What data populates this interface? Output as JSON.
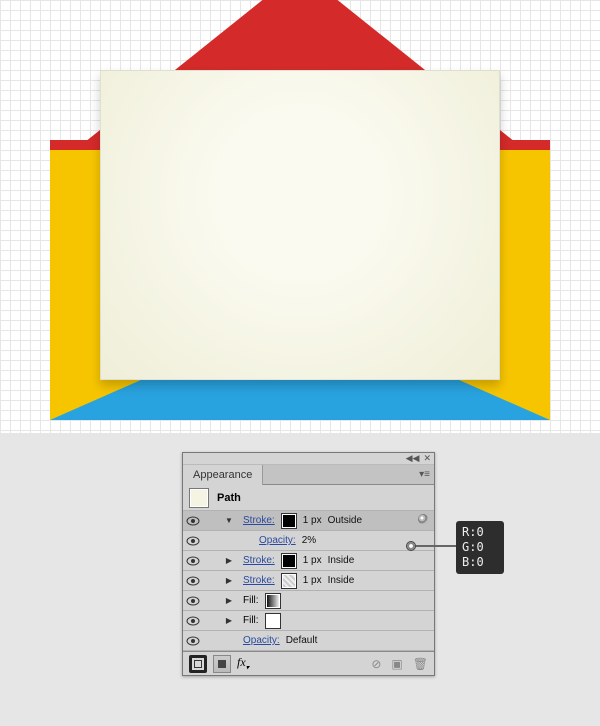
{
  "panel": {
    "title": "Appearance",
    "object_label": "Path",
    "rows": [
      {
        "kind": "stroke",
        "label": "Stroke:",
        "value": "1 px",
        "align": "Outside",
        "swatch": "black",
        "disclosure": "open",
        "selected": true,
        "targeted": true
      },
      {
        "kind": "opacity",
        "label": "Opacity:",
        "value": "2%",
        "indent": true
      },
      {
        "kind": "stroke",
        "label": "Stroke:",
        "value": "1 px",
        "align": "Inside",
        "swatch": "black",
        "disclosure": "closed"
      },
      {
        "kind": "stroke",
        "label": "Stroke:",
        "value": "1 px",
        "align": "Inside",
        "swatch": "hatch",
        "disclosure": "closed"
      },
      {
        "kind": "fill",
        "label": "Fill:",
        "swatch": "grad",
        "disclosure": "closed"
      },
      {
        "kind": "fill",
        "label": "Fill:",
        "swatch": "white",
        "disclosure": "closed"
      },
      {
        "kind": "opacity",
        "label": "Opacity:",
        "value": "Default"
      }
    ]
  },
  "rgb": {
    "r": "R:0",
    "g": "G:0",
    "b": "B:0"
  },
  "footer": {
    "fx": "fx"
  },
  "glyphs": {
    "collapse": "◀◀",
    "close": "✕",
    "menu": "▾≡",
    "tri_down": "▼",
    "tri_right": "▶",
    "no": "⊘",
    "new": "▣",
    "trash": "🗑"
  }
}
